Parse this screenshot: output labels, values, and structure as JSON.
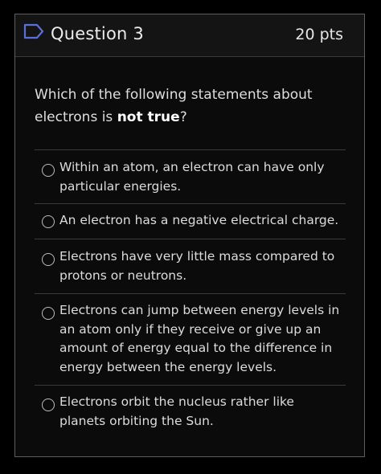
{
  "question": {
    "title": "Question 3",
    "points": "20 pts",
    "prompt_before": "Which of the following statements about electrons is ",
    "prompt_emphasis": "not true",
    "prompt_after": "?"
  },
  "answers": [
    {
      "label": "Within an atom, an electron can have only particular energies."
    },
    {
      "label": "An electron has a negative electrical charge."
    },
    {
      "label": "Electrons have very little mass compared to protons or neutrons."
    },
    {
      "label": "Electrons can jump between energy levels in an atom only if they receive or give up an amount of energy equal to the difference in energy between the energy levels."
    },
    {
      "label": "Electrons orbit the nucleus rather like planets orbiting the Sun."
    }
  ],
  "colors": {
    "background": "#000000",
    "card_border": "#5e5e5e",
    "flag_icon": "#5b6fd6"
  },
  "icons": {
    "header": "flag-icon",
    "answer": "radio-circle-icon"
  }
}
